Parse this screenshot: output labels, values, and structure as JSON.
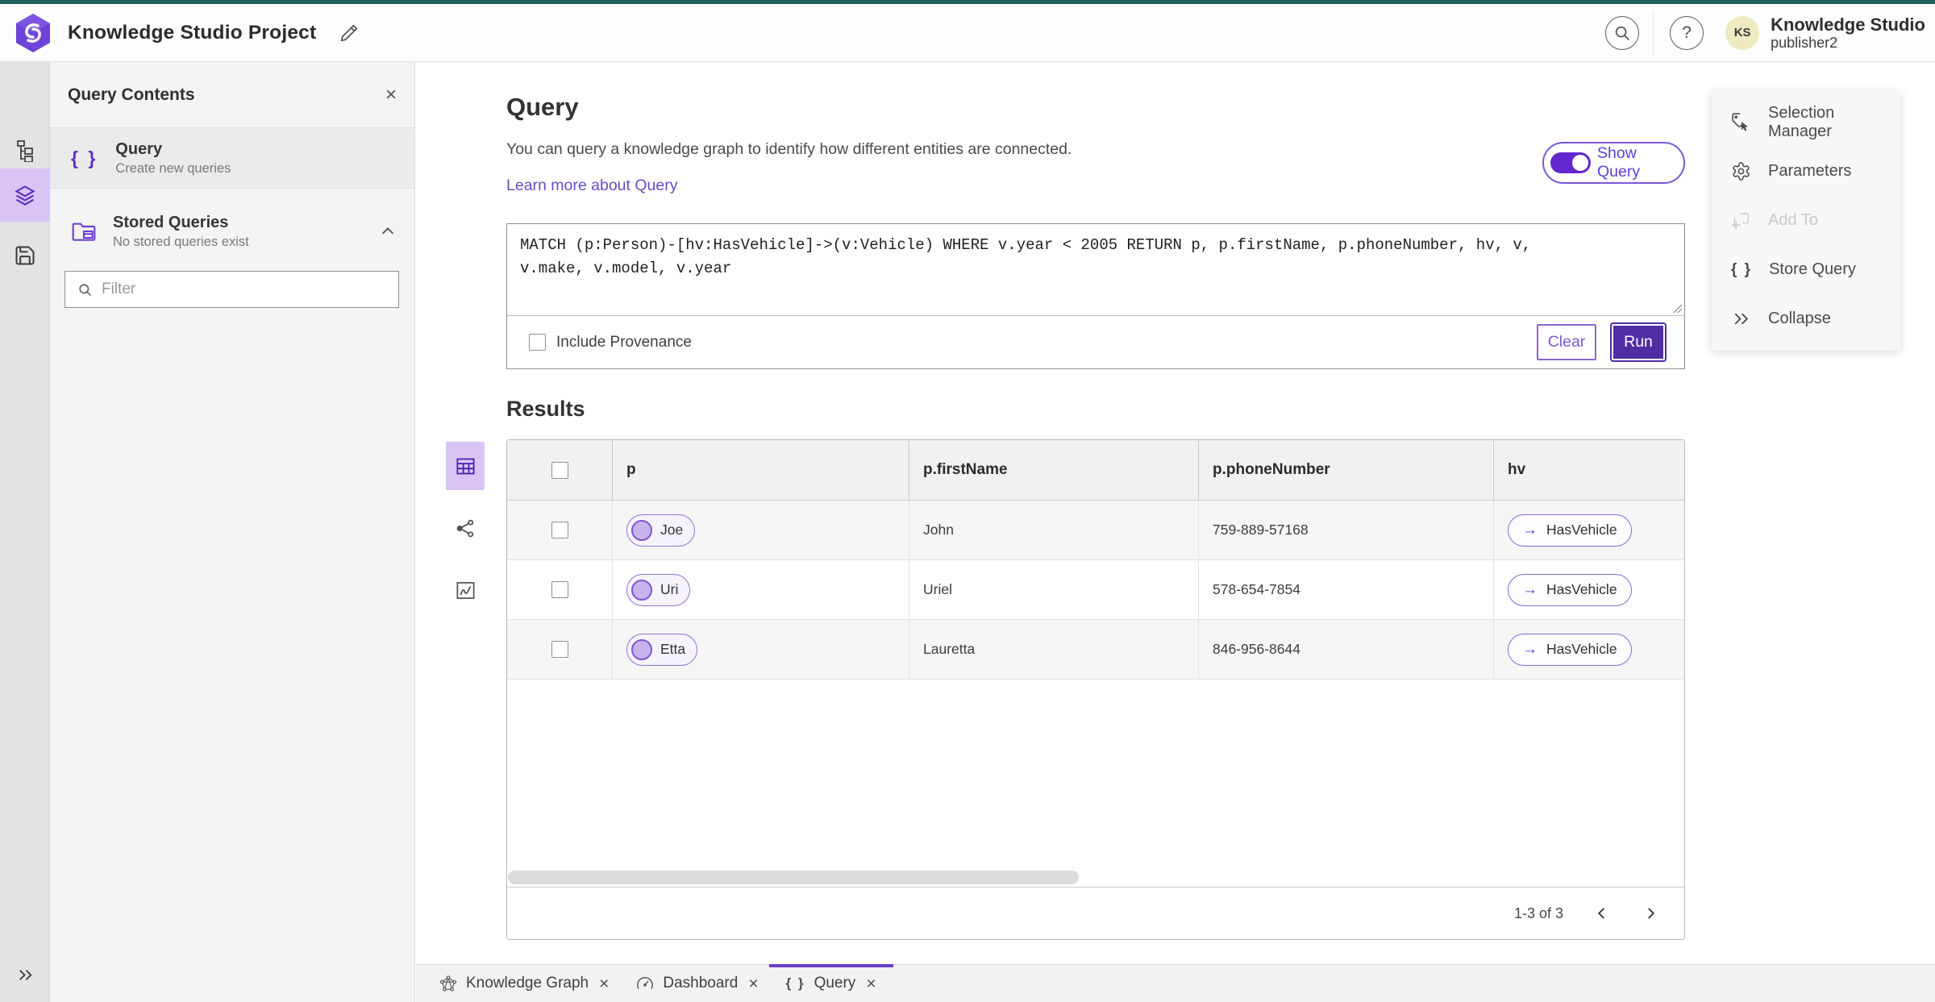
{
  "glyphs": {
    "close": "×",
    "braces": "{ }",
    "question": "?",
    "arrow_right": "→"
  },
  "header": {
    "app_title": "Knowledge Studio Project",
    "user_initials": "KS",
    "user_name": "Knowledge Studio",
    "user_role": "publisher2"
  },
  "left_panel": {
    "title": "Query Contents",
    "query_item": {
      "title": "Query",
      "subtitle": "Create new queries"
    },
    "stored_item": {
      "title": "Stored Queries",
      "subtitle": "No stored queries exist"
    },
    "filter_placeholder": "Filter"
  },
  "query_section": {
    "title": "Query",
    "description": "You can query a knowledge graph to identify how different entities are connected.",
    "learn_more": "Learn more about Query",
    "show_query": "Show Query",
    "query_lines": [
      "MATCH (p:Person)-[hv:HasVehicle]->(v:Vehicle) WHERE v.year < 2005 RETURN p, p.firstName, p.phoneNumber, hv, v,",
      "v.make, v.model, v.year"
    ],
    "include_provenance": "Include Provenance",
    "clear": "Clear",
    "run": "Run"
  },
  "results": {
    "title": "Results",
    "columns": [
      "p",
      "p.firstName",
      "p.phoneNumber",
      "hv"
    ],
    "rows": [
      {
        "p": "Joe",
        "firstName": "John",
        "phone": "759-889-57168",
        "hv": "HasVehicle"
      },
      {
        "p": "Uri",
        "firstName": "Uriel",
        "phone": "578-654-7854",
        "hv": "HasVehicle"
      },
      {
        "p": "Etta",
        "firstName": "Lauretta",
        "phone": "846-956-8644",
        "hv": "HasVehicle"
      }
    ],
    "pagination": "1-3 of 3"
  },
  "tools": {
    "selection_manager": "Selection Manager",
    "parameters": "Parameters",
    "add_to": "Add To",
    "store_query": "Store Query",
    "collapse": "Collapse"
  },
  "tabs": {
    "knowledge_graph": "Knowledge Graph",
    "dashboard": "Dashboard",
    "query": "Query"
  },
  "colors": {
    "accent": "#5d33c5",
    "accent_fill": "#4f2da5",
    "accent_light": "#d9c4f6",
    "top_strip": "#215e60",
    "link": "#6a4cc6",
    "avatar_bg": "#efeac2"
  }
}
